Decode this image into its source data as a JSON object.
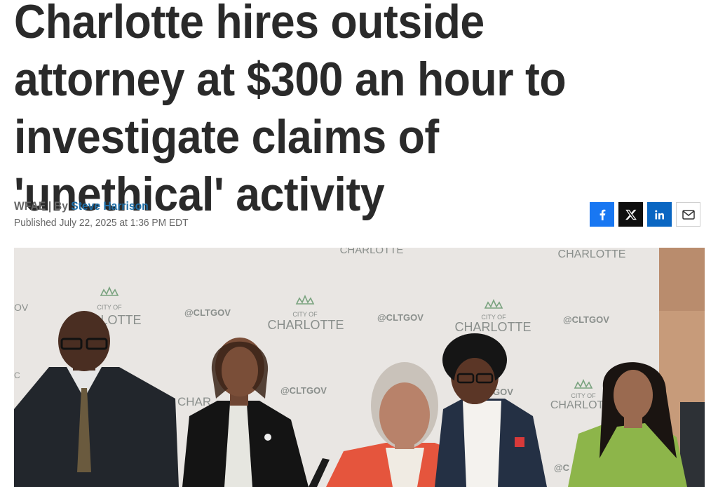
{
  "article": {
    "headline": "Charlotte hires outside attorney at $300 an hour to investigate claims of 'unethical' activity",
    "source": "WFAE",
    "separator": "|",
    "by_prefix": "By",
    "author": "Steve Harrison",
    "published": "Published July 22, 2025 at 1:36 PM EDT"
  },
  "share": {
    "buttons": [
      {
        "name": "facebook",
        "glyph": "f",
        "color": "#1877f2"
      },
      {
        "name": "x",
        "glyph": "X",
        "color": "#0f0f0f"
      },
      {
        "name": "linkedin",
        "glyph": "in",
        "color": "#0a66c2"
      },
      {
        "name": "email",
        "icon": "envelope-icon",
        "color": "#ffffff"
      }
    ]
  },
  "photo": {
    "backdrop": {
      "city_of": "CITY OF",
      "charlotte": "CHARLOTTE",
      "handle": "@CLTGOV",
      "fragment_ov": "OV",
      "fragment_rlotte": "RLOTTE",
      "fragment_char": "CHAR",
      "fragment_charlott": "CHARLOTT",
      "fragment_gov": "GOV",
      "fragment_c": "C",
      "fragment_oc": "@C"
    }
  },
  "colors": {
    "link": "#1f6fa8",
    "headline": "#2a2a2a",
    "meta": "#666666",
    "backdrop": "#e7e4e2"
  }
}
